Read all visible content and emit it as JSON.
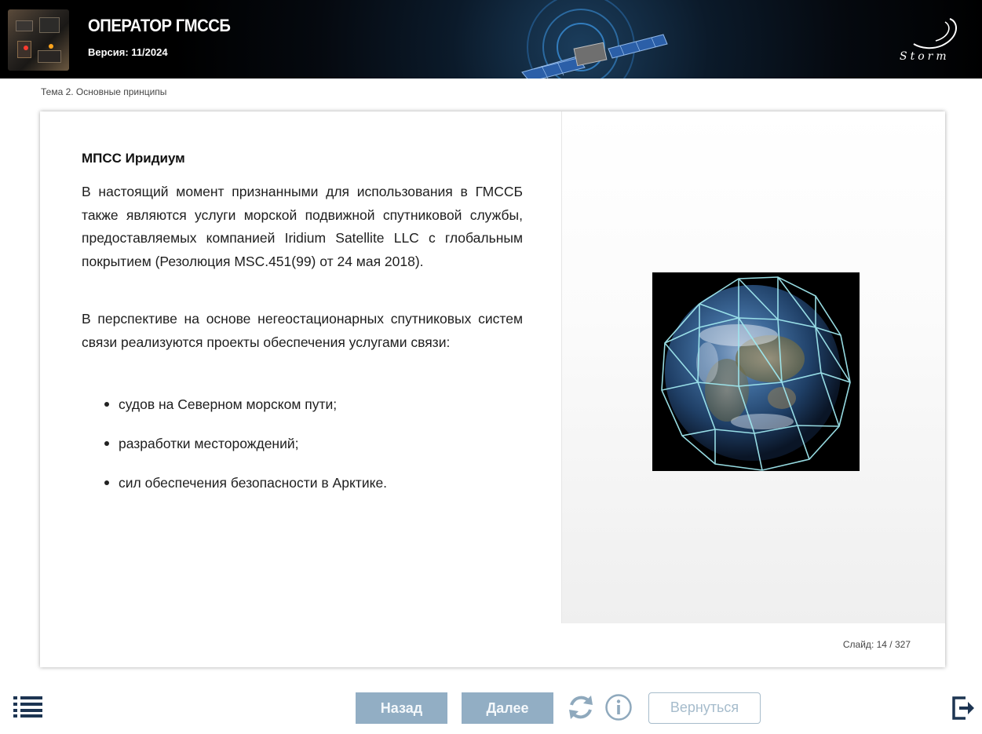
{
  "header": {
    "title": "ОПЕРАТОР ГМССБ",
    "version": "Версия: 11/2024",
    "logo_text": "Storm"
  },
  "breadcrumb": "Тема 2. Основные принципы",
  "slide": {
    "title": "МПСС Иридиум",
    "paragraph1": "В настоящий момент признанными для использования в ГМССБ также являются услуги морской подвижной спутниковой службы, предоставляемых компанией Iridium Satellite LLC с глобальным покрытием (Резолюция MSC.451(99) от 24 мая 2018).",
    "paragraph2": "В перспективе на основе негеостационарных спутниковых систем связи реализуются проекты обеспечения услугами связи:",
    "bullets": [
      "судов на Северном морском пути;",
      "разработки месторождений;",
      "сил обеспечения безопасности в Арктике."
    ],
    "counter_label": "Слайд:",
    "counter_value": "14 / 327"
  },
  "footer": {
    "back_label": "Назад",
    "next_label": "Далее",
    "return_label": "Вернуться"
  },
  "icons": {
    "menu": "list-menu-icon",
    "reload": "reload-icon",
    "info": "info-icon",
    "exit": "exit-icon"
  },
  "colors": {
    "nav_button": "#92aec4",
    "return_border": "#a7bccb",
    "icon_dark": "#1d3552",
    "icon_light": "#8fa9bd"
  }
}
